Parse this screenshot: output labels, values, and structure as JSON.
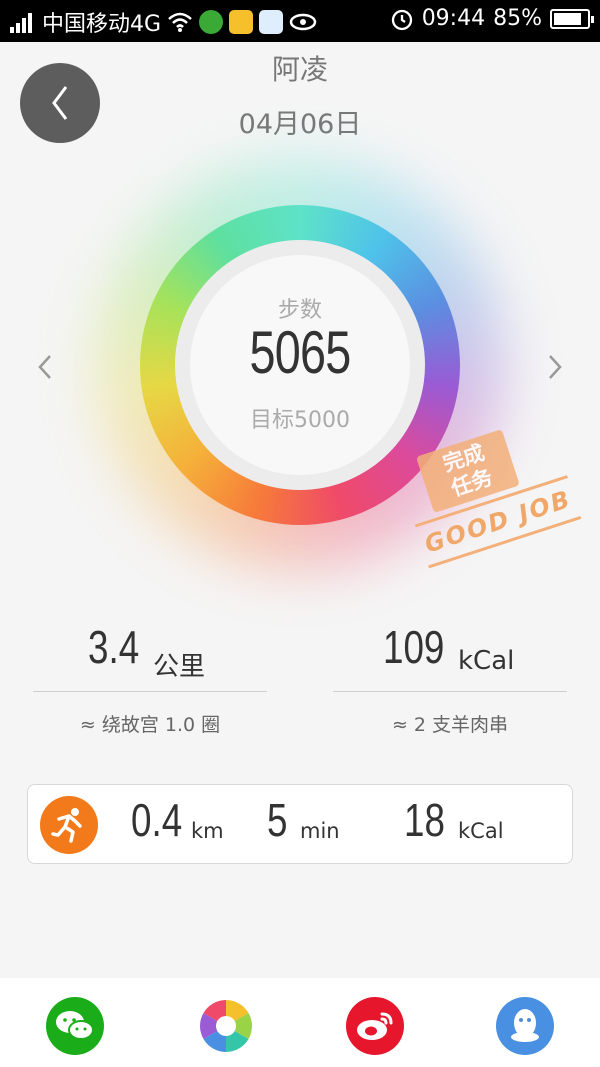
{
  "status_bar": {
    "carrier": "中国移动4G",
    "time": "09:44",
    "battery_percent": "85%",
    "battery_level": 0.85,
    "icons": [
      "signal-icon",
      "wifi-icon",
      "app-green-icon",
      "app-game-icon",
      "app-flv-icon",
      "app-eye-icon",
      "alarm-icon",
      "battery-icon"
    ]
  },
  "header": {
    "title": "阿凌",
    "date": "04月06日",
    "back_icon": "chevron-left-icon"
  },
  "ring": {
    "label": "步数",
    "value": "5065",
    "goal": "目标5000",
    "progress": 1.0
  },
  "stamp": {
    "line1": "完成",
    "line2": "任务",
    "text": "GOOD JOB"
  },
  "stats": {
    "distance": {
      "value": "3.4",
      "unit": "公里",
      "note": "≈ 绕故宫 1.0 圈"
    },
    "calories": {
      "value": "109",
      "unit": "kCal",
      "note": "≈ 2 支羊肉串"
    }
  },
  "activity": {
    "icon": "running-icon",
    "distance": {
      "value": "0.4",
      "unit": "km"
    },
    "duration": {
      "value": "5",
      "unit": "min"
    },
    "calories": {
      "value": "18",
      "unit": "kCal"
    }
  },
  "share": {
    "items": [
      "wechat-icon",
      "moments-icon",
      "weibo-icon",
      "qq-icon"
    ],
    "colors": {
      "wechat": "#1aad19",
      "weibo": "#e6162d",
      "qq": "#4a90e2"
    }
  }
}
